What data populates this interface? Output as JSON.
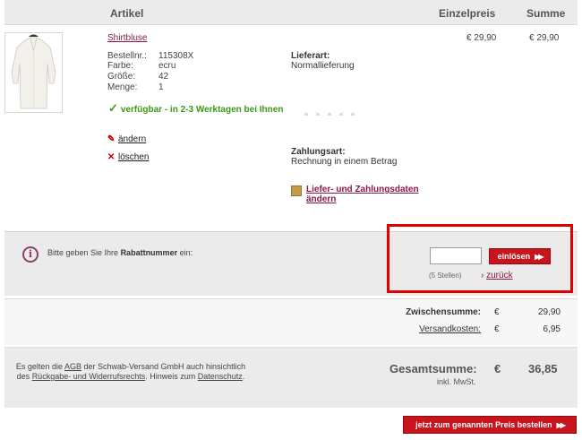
{
  "header": {
    "artikel": "Artikel",
    "einzelpreis": "Einzelpreis",
    "summe": "Summe"
  },
  "product": {
    "name": "Shirtbluse",
    "specs": [
      {
        "key": "Bestellnr.:",
        "value": "115308X"
      },
      {
        "key": "Farbe:",
        "value": "ecru"
      },
      {
        "key": "Größe:",
        "value": "42"
      },
      {
        "key": "Menge:",
        "value": "1"
      }
    ],
    "availability": "verfügbar - in 2-3 Werktagen bei Ihnen",
    "edit_label": "ändern",
    "delete_label": "löschen",
    "unit_price": "€ 29,90",
    "total_price": "€ 29,90"
  },
  "delivery": {
    "lieferart_label": "Lieferart:",
    "lieferart_value": "Normallieferung",
    "zahlungsart_label": "Zahlungsart:",
    "zahlungsart_value": "Rechnung in einem Betrag",
    "change_link": "Liefer- und Zahlungsdaten ändern"
  },
  "discount": {
    "prompt_prefix": "Bitte geben Sie Ihre ",
    "prompt_bold": "Rabattnummer",
    "prompt_suffix": " ein:",
    "code_value": "",
    "redeem_button": "einlösen",
    "hint": "(5 Stellen)",
    "back_link": "zurück"
  },
  "totals": {
    "subtotal_label": "Zwischensumme:",
    "subtotal_currency": "€",
    "subtotal_value": "29,90",
    "shipping_label": "Versandkosten:",
    "shipping_currency": "€",
    "shipping_value": "6,95",
    "grand_label": "Gesamtsumme:",
    "grand_currency": "€",
    "grand_value": "36,85",
    "tax_note": "inkl. MwSt."
  },
  "legal": {
    "t1": "Es gelten die ",
    "agb": "AGB",
    "t2": " der Schwab-Versand GmbH auch hinsichtlich des ",
    "rueckgabe": "Rückgabe- und Widerrufsrechts",
    "t3": ". Hinweis zum ",
    "datenschutz": "Datenschutz",
    "t4": "."
  },
  "order_button": "jetzt zum genannten Preis bestellen",
  "colors": {
    "accent": "#c8141c",
    "link": "#8b1a4a",
    "available": "#3a9a16",
    "highlight_frame": "#e00000"
  }
}
